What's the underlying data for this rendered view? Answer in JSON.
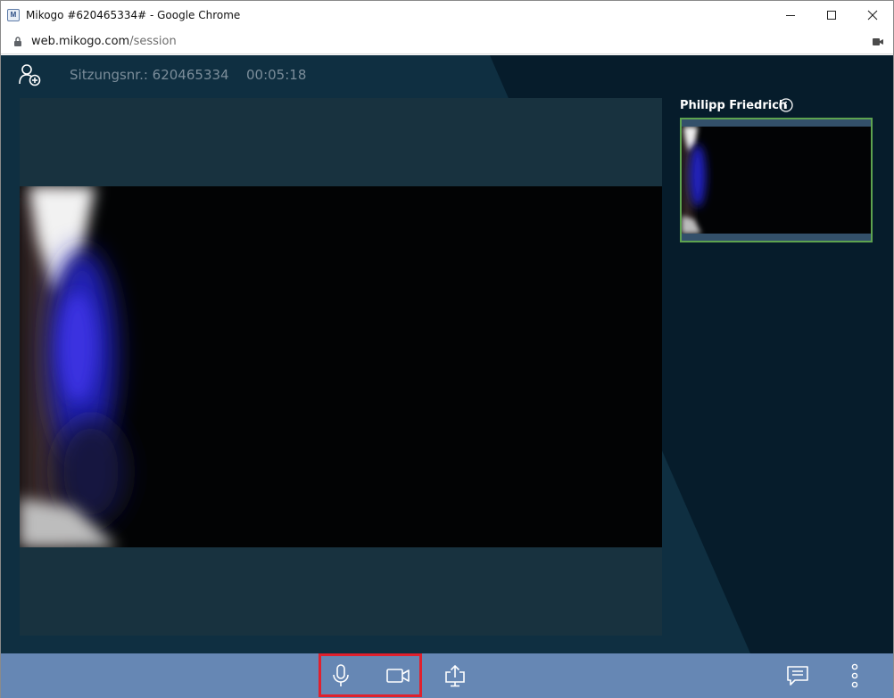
{
  "browser": {
    "window_title": "Mikogo #620465334# - Google Chrome",
    "app_icon_letter": "M",
    "url_host": "web.mikogo.com",
    "url_path": "/session",
    "controls": [
      "minimize-icon",
      "maximize-icon",
      "close-icon"
    ]
  },
  "session": {
    "number_label": "Sitzungsnr.: 620465334",
    "elapsed": "00:05:18",
    "add_participant_icon": "add-user-icon"
  },
  "participants": [
    {
      "name": "Philipp Friedrich",
      "border_color": "#5da34f",
      "info_icon": "info-icon"
    }
  ],
  "toolbar": {
    "background": "#6687b4",
    "highlight_color": "#e0202d",
    "buttons": [
      {
        "icon": "microphone-icon",
        "highlighted": true
      },
      {
        "icon": "camera-icon",
        "highlighted": true
      },
      {
        "icon": "share-screen-icon",
        "highlighted": false
      },
      {
        "icon": "chat-icon",
        "highlighted": false
      },
      {
        "icon": "more-vertical-icon",
        "highlighted": false
      }
    ]
  },
  "colors": {
    "content_bg": "#061c2b",
    "stage_bg": "#18323f",
    "session_text": "#7b8d9a"
  }
}
